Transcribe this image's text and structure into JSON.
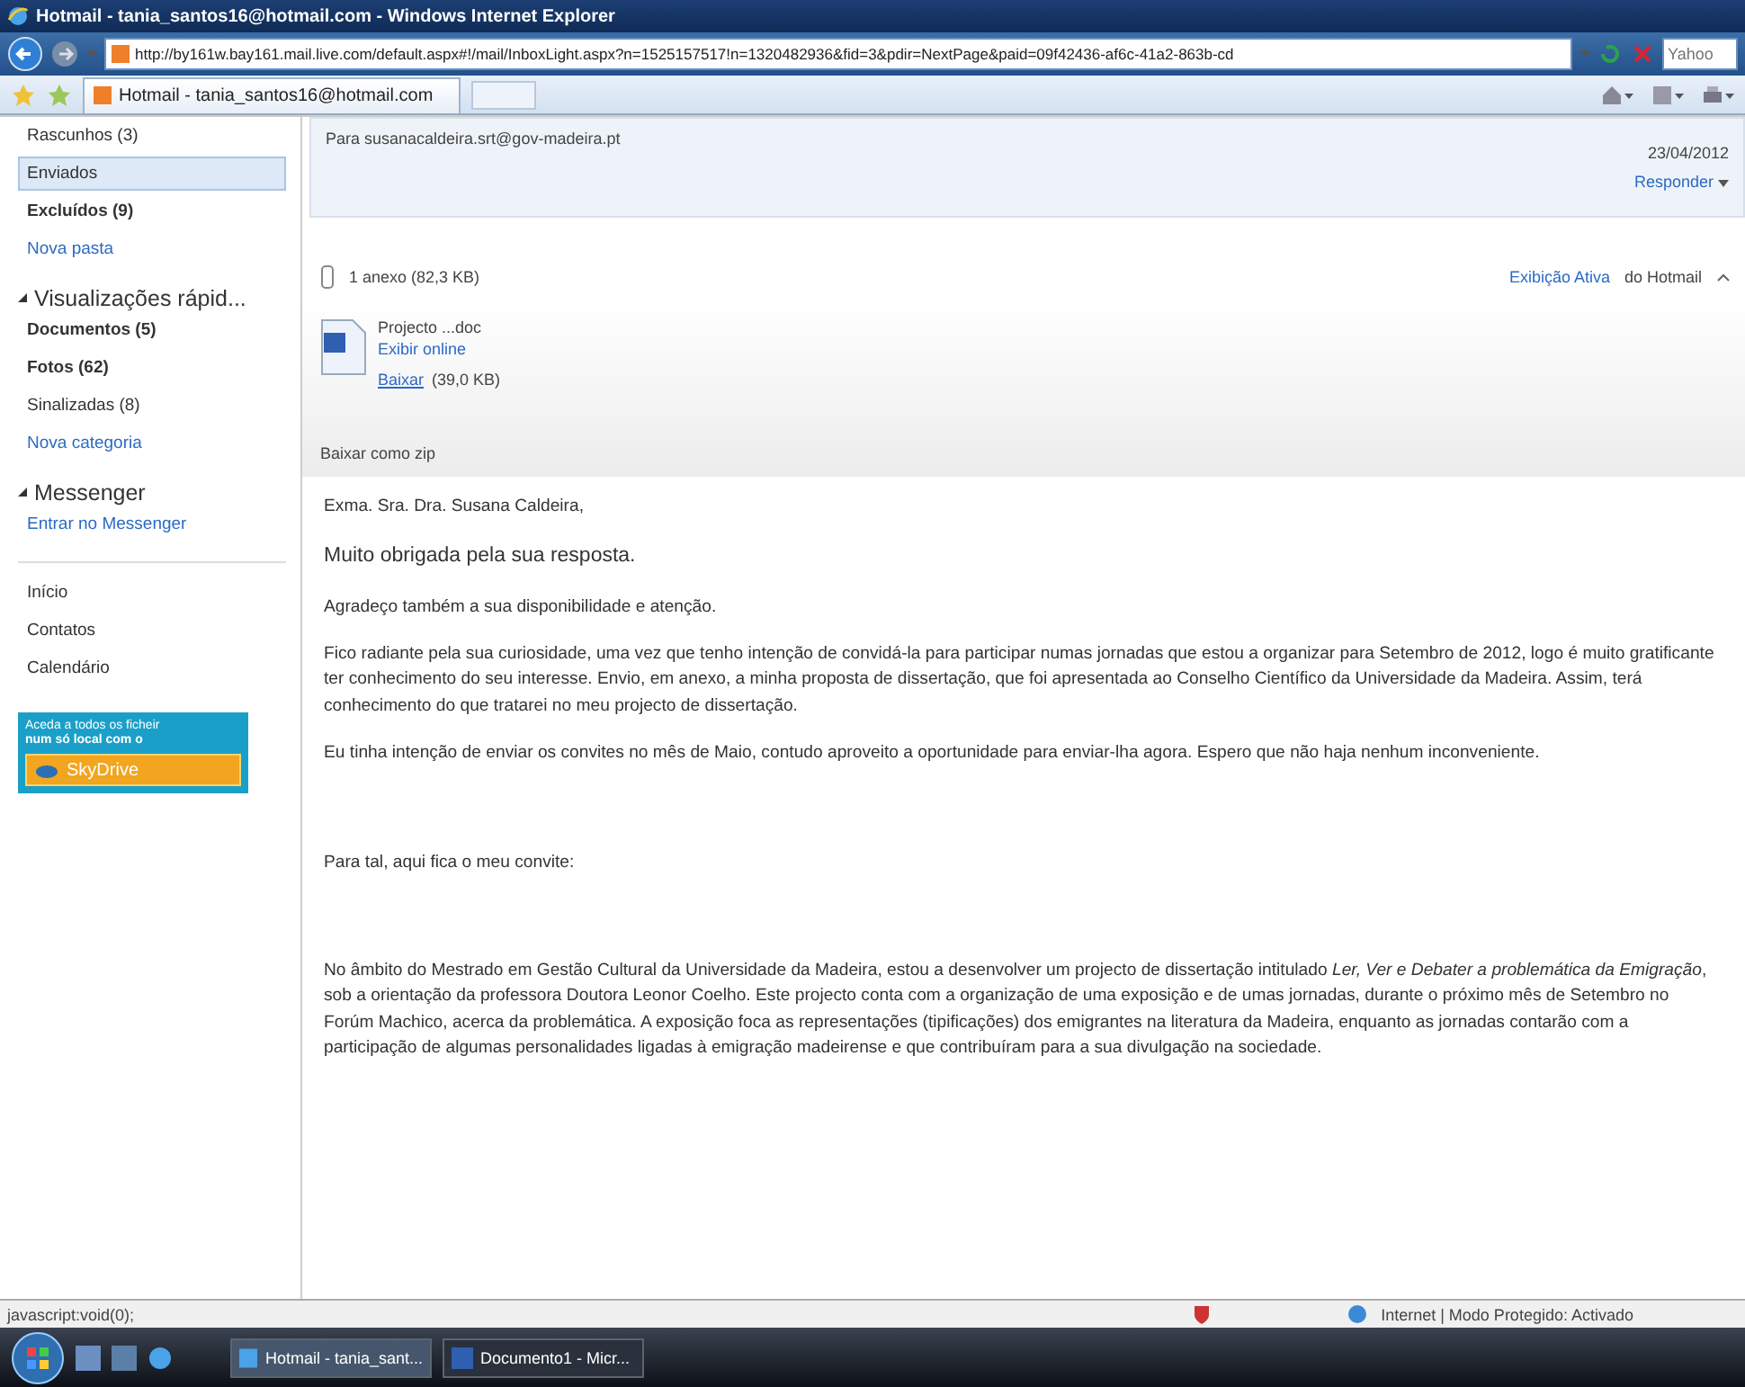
{
  "window": {
    "title": "Hotmail - tania_santos16@hotmail.com - Windows Internet Explorer"
  },
  "address_bar": {
    "url": "http://by161w.bay161.mail.live.com/default.aspx#!/mail/InboxLight.aspx?n=1525157517!n=1320482936&fid=3&pdir=NextPage&paid=09f42436-af6c-41a2-863b-cd",
    "search_placeholder": "Yahoo"
  },
  "tab": {
    "title": "Hotmail - tania_santos16@hotmail.com"
  },
  "sidebar": {
    "folders": [
      {
        "label": "Rascunhos (3)",
        "kind": "folder",
        "unread": false,
        "selected": false
      },
      {
        "label": "Enviados",
        "kind": "folder",
        "unread": false,
        "selected": true
      },
      {
        "label": "Excluídos (9)",
        "kind": "folder",
        "unread": true,
        "selected": false
      },
      {
        "label": "Nova pasta",
        "kind": "link",
        "unread": false,
        "selected": false
      }
    ],
    "quick_views": {
      "heading": "Visualizações rápid...",
      "expanded": true,
      "items": [
        {
          "label": "Documentos (5)",
          "kind": "folder",
          "unread": true,
          "selected": false
        },
        {
          "label": "Fotos (62)",
          "kind": "folder",
          "unread": true,
          "selected": false
        },
        {
          "label": "Sinalizadas (8)",
          "kind": "folder",
          "unread": false,
          "selected": false
        },
        {
          "label": "Nova categoria",
          "kind": "link",
          "unread": false,
          "selected": false
        }
      ]
    },
    "messenger": {
      "heading": "Messenger",
      "expanded": true,
      "link": "Entrar no Messenger"
    },
    "nav": [
      "Início",
      "Contatos",
      "Calendário"
    ],
    "ad": {
      "line_1": "Aceda a todos os ficheir",
      "line_2": "num só local com o",
      "button": "SkyDrive"
    }
  },
  "message": {
    "to": "Para susanacaldeira.srt@gov-madeira.pt",
    "date": "23/04/2012",
    "reply": "Responder",
    "attachments": {
      "summary": "1 anexo (82,3 KB)",
      "active_view_link": "Exibição Ativa",
      "active_view_suffix": "do Hotmail",
      "files": [
        {
          "name": "Projecto ...doc",
          "view": "Exibir online",
          "download": "Baixar",
          "size": "(39,0 KB)"
        }
      ],
      "zip": "Baixar como zip"
    },
    "body": [
      {
        "kind": "text",
        "text": "Exma. Sra. Dra. Susana Caldeira,"
      },
      {
        "kind": "large",
        "text": "Muito obrigada pela sua resposta."
      },
      {
        "kind": "text",
        "text": "Agradeço também a sua disponibilidade e atenção."
      },
      {
        "kind": "text",
        "text": "Fico radiante pela sua curiosidade, uma vez que tenho intenção de convidá-la para participar numas jornadas que estou a organizar para Setembro de 2012, logo é muito gratificante ter conhecimento do seu interesse. Envio, em anexo, a minha proposta de dissertação, que foi apresentada ao Conselho Científico da Universidade da Madeira. Assim, terá conhecimento do que tratarei no meu projecto de dissertação."
      },
      {
        "kind": "text",
        "text": "Eu tinha intenção de enviar os convites no mês de Maio, contudo aproveito a oportunidade para enviar-lha agora. Espero que não haja nenhum inconveniente."
      },
      {
        "kind": "spacer"
      },
      {
        "kind": "text",
        "text": "Para tal, aqui fica o meu convite:"
      },
      {
        "kind": "spacer"
      },
      {
        "kind": "text",
        "text": "No âmbito do Mestrado em Gestão Cultural da Universidade da Madeira, estou a desenvolver um projecto de dissertação intitulado *Ler, Ver e Debater a problemática da Emigração*, sob a orientação da professora Doutora Leonor Coelho. Este projecto conta com a organização de uma exposição e de umas jornadas, durante o próximo mês de Setembro no Forúm Machico, acerca da problemática. A exposição foca as representações (tipificações) dos emigrantes na literatura da Madeira, enquanto as jornadas contarão com a participação de algumas personalidades ligadas à emigração madeirense e que contribuíram para a sua divulgação na sociedade."
      }
    ]
  },
  "status_bar": {
    "text": "javascript:void(0);",
    "zone": "Internet | Modo Protegido: Activado"
  },
  "taskbar": {
    "windows": [
      {
        "label": "Hotmail - tania_sant...",
        "selected": true
      },
      {
        "label": "Documento1 - Micr...",
        "selected": false
      }
    ]
  }
}
